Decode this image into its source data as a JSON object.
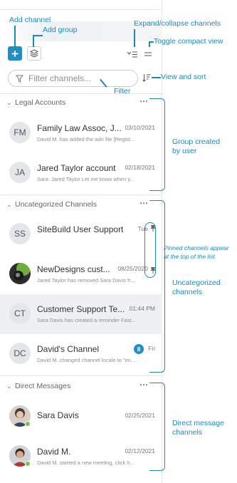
{
  "toolbar": {
    "add_label": "+",
    "search_placeholder": "Filter channels..."
  },
  "sections": [
    {
      "title": "Legal Accounts",
      "rows": [
        {
          "initials": "FM",
          "title": "Family Law Assoc, J...",
          "date": "03/10/2021",
          "preview": "David M. has added the wiki file [Regist..."
        },
        {
          "initials": "JA",
          "title": "Jared Taylor account",
          "date": "02/18/2021",
          "preview": "Sara: Jared Taylor Let me know when y..."
        }
      ]
    },
    {
      "title": "Uncategorized Channels",
      "rows": [
        {
          "initials": "SS",
          "title": "SiteBuild User Support",
          "date": "Tue",
          "preview": ""
        },
        {
          "initials": "",
          "title": "NewDesigns cust...",
          "date": "08/25/2020",
          "preview": "Jared Taylor has removed Sara Davis fr..."
        },
        {
          "initials": "CT",
          "title": "Customer Support Te...",
          "date": "01:44 PM",
          "preview": "Sara Davis has created a reminder Fast..."
        },
        {
          "initials": "DC",
          "title": "David's Channel",
          "date": "Fri",
          "badge": "8",
          "preview": "David M. changed channel locale to \"en..."
        }
      ]
    },
    {
      "title": "Direct Messages",
      "rows": [
        {
          "initials": "",
          "title": "Sara Davis",
          "date": "02/25/2021",
          "preview": ""
        },
        {
          "initials": "",
          "title": "David M.",
          "date": "02/12/2021",
          "preview": "David M. started a new meeting, click h..."
        }
      ]
    }
  ],
  "annotations": {
    "add_channel": "Add channel",
    "add_group": "Add group",
    "expand_collapse": "Expand/collapse channels",
    "toggle_compact": "Toggle compact view",
    "view_sort": "View and sort",
    "filter": "Filter",
    "group_created_1": "Group created",
    "group_created_2": "by user",
    "pinned_1": "Pinned channels appear",
    "pinned_2": "at the top of the list",
    "uncategorized_1": "Uncategorized",
    "uncategorized_2": "channels",
    "direct_1": "Direct message",
    "direct_2": "channels"
  },
  "colors": {
    "accent": "#1f8fc4",
    "annotation": "#1a8ab8",
    "online": "#7bc04a",
    "selected_row": "#edf1f4"
  }
}
